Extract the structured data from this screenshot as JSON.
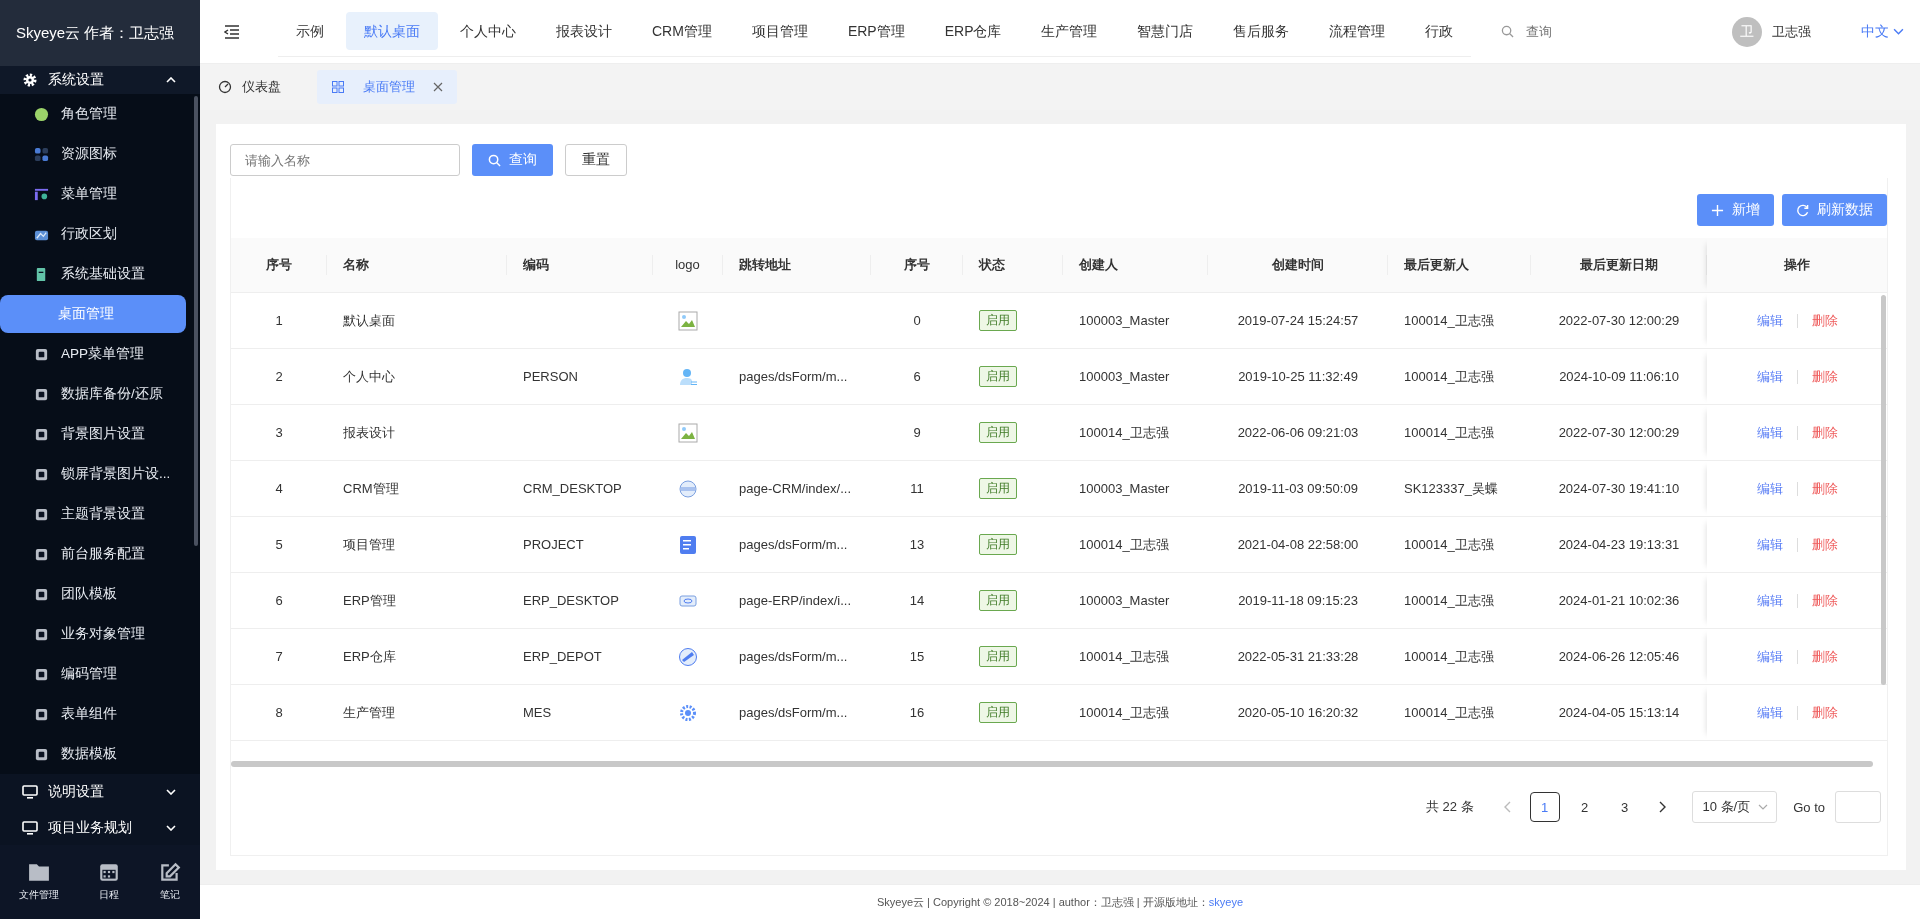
{
  "sidebar": {
    "title": "Skyeye云 作者：卫志强",
    "groups": [
      {
        "label": "系统设置",
        "expanded": true,
        "items": [
          {
            "label": "角色管理",
            "selected": false
          },
          {
            "label": "资源图标",
            "selected": false
          },
          {
            "label": "菜单管理",
            "selected": false
          },
          {
            "label": "行政区划",
            "selected": false
          },
          {
            "label": "系统基础设置",
            "selected": false
          },
          {
            "label": "桌面管理",
            "selected": true
          },
          {
            "label": "APP菜单管理",
            "selected": false
          },
          {
            "label": "数据库备份/还原",
            "selected": false
          },
          {
            "label": "背景图片设置",
            "selected": false
          },
          {
            "label": "锁屏背景图片设...",
            "selected": false
          },
          {
            "label": "主题背景设置",
            "selected": false
          },
          {
            "label": "前台服务配置",
            "selected": false
          },
          {
            "label": "团队模板",
            "selected": false
          },
          {
            "label": "业务对象管理",
            "selected": false
          },
          {
            "label": "编码管理",
            "selected": false
          },
          {
            "label": "表单组件",
            "selected": false
          },
          {
            "label": "数据模板",
            "selected": false
          }
        ]
      },
      {
        "label": "说明设置",
        "expanded": false
      },
      {
        "label": "项目业务规划",
        "expanded": false
      }
    ],
    "dock": [
      {
        "label": "文件管理"
      },
      {
        "label": "日程"
      },
      {
        "label": "笔记"
      }
    ]
  },
  "topnav": {
    "tabs": [
      {
        "label": "示例",
        "selected": false
      },
      {
        "label": "默认桌面",
        "selected": true
      },
      {
        "label": "个人中心",
        "selected": false
      },
      {
        "label": "报表设计",
        "selected": false
      },
      {
        "label": "CRM管理",
        "selected": false
      },
      {
        "label": "项目管理",
        "selected": false
      },
      {
        "label": "ERP管理",
        "selected": false
      },
      {
        "label": "ERP仓库",
        "selected": false
      },
      {
        "label": "生产管理",
        "selected": false
      },
      {
        "label": "智慧门店",
        "selected": false
      },
      {
        "label": "售后服务",
        "selected": false
      },
      {
        "label": "流程管理",
        "selected": false
      },
      {
        "label": "行政",
        "selected": false
      }
    ],
    "search": {
      "placeholder": "查询"
    },
    "avatar": "卫",
    "user": "卫志强",
    "language": "中文"
  },
  "page_tabs": [
    {
      "label": "仪表盘",
      "selected": false,
      "closable": false
    },
    {
      "label": "桌面管理",
      "selected": true,
      "closable": true
    }
  ],
  "filter": {
    "placeholder": "请输入名称",
    "search_button": "查询",
    "reset_button": "重置"
  },
  "actions": [
    {
      "label": "新增",
      "kind": "add"
    },
    {
      "label": "刷新数据",
      "kind": "refresh"
    }
  ],
  "table": {
    "columns": [
      "序号",
      "名称",
      "编码",
      "logo",
      "跳转地址",
      "序号",
      "状态",
      "创建人",
      "创建时间",
      "最后更新人",
      "最后更新日期",
      "操作"
    ],
    "rows": [
      {
        "index": "1",
        "name": "默认桌面",
        "kind": "broken",
        "order": "0",
        "status": "启用",
        "creator": "100003_Master",
        "created": "2019-07-24 15:24:57",
        "updater": "100014_卫志强",
        "updated": "2022-07-30 12:00:29",
        "actions": [
          "编辑",
          "删除"
        ]
      },
      {
        "index": "2",
        "name": "个人中心",
        "code": "PERSON",
        "kind": "person",
        "url": "pages/dsForm/m...",
        "order": "6",
        "status": "启用",
        "creator": "100003_Master",
        "created": "2019-10-25 11:32:49",
        "updater": "100014_卫志强",
        "updated": "2024-10-09 11:06:10",
        "actions": [
          "编辑",
          "删除"
        ]
      },
      {
        "index": "3",
        "name": "报表设计",
        "kind": "broken",
        "order": "9",
        "status": "启用",
        "creator": "100014_卫志强",
        "created": "2022-06-06 09:21:03",
        "updater": "100014_卫志强",
        "updated": "2022-07-30 12:00:29",
        "actions": [
          "编辑",
          "删除"
        ]
      },
      {
        "index": "4",
        "name": "CRM管理",
        "code": "CRM_DESKTOP",
        "kind": "disc",
        "url": "page-CRM/index/...",
        "order": "11",
        "status": "启用",
        "creator": "100003_Master",
        "created": "2019-11-03 09:50:09",
        "updater": "SK123337_吴蝶",
        "updated": "2024-07-30 19:41:10",
        "actions": [
          "编辑",
          "删除"
        ]
      },
      {
        "index": "5",
        "name": "项目管理",
        "code": "PROJECT",
        "kind": "document",
        "url": "pages/dsForm/m...",
        "order": "13",
        "status": "启用",
        "creator": "100014_卫志强",
        "created": "2021-04-08 22:58:00",
        "updater": "100014_卫志强",
        "updated": "2024-04-23 19:13:31",
        "actions": [
          "编辑",
          "删除"
        ]
      },
      {
        "index": "6",
        "name": "ERP管理",
        "code": "ERP_DESKTOP",
        "kind": "card",
        "url": "page-ERP/index/i...",
        "order": "14",
        "status": "启用",
        "creator": "100003_Master",
        "created": "2019-11-18 09:15:23",
        "updater": "100014_卫志强",
        "updated": "2024-01-21 10:02:36",
        "actions": [
          "编辑",
          "删除"
        ]
      },
      {
        "index": "7",
        "name": "ERP仓库",
        "code": "ERP_DEPOT",
        "kind": "globe",
        "url": "pages/dsForm/m...",
        "order": "15",
        "status": "启用",
        "creator": "100014_卫志强",
        "created": "2022-05-31 21:33:28",
        "updater": "100014_卫志强",
        "updated": "2024-06-26 12:05:46",
        "actions": [
          "编辑",
          "删除"
        ]
      },
      {
        "index": "8",
        "name": "生产管理",
        "code": "MES",
        "kind": "gear",
        "url": "pages/dsForm/m...",
        "order": "16",
        "status": "启用",
        "creator": "100014_卫志强",
        "created": "2020-05-10 16:20:32",
        "updater": "100014_卫志强",
        "updated": "2024-04-05 15:13:14",
        "actions": [
          "编辑",
          "删除"
        ]
      }
    ]
  },
  "pagination": {
    "total": "共 22 条",
    "pages": [
      {
        "label": "1",
        "selected": true
      },
      {
        "label": "2",
        "selected": false
      },
      {
        "label": "3",
        "selected": false
      }
    ],
    "page_size": "10 条/页",
    "goto_label": "Go to"
  },
  "footer": {
    "text": "Skyeye云 | Copyright © 2018~2024 | author：卫志强 | 开源版地址：",
    "link": "skyeye"
  }
}
